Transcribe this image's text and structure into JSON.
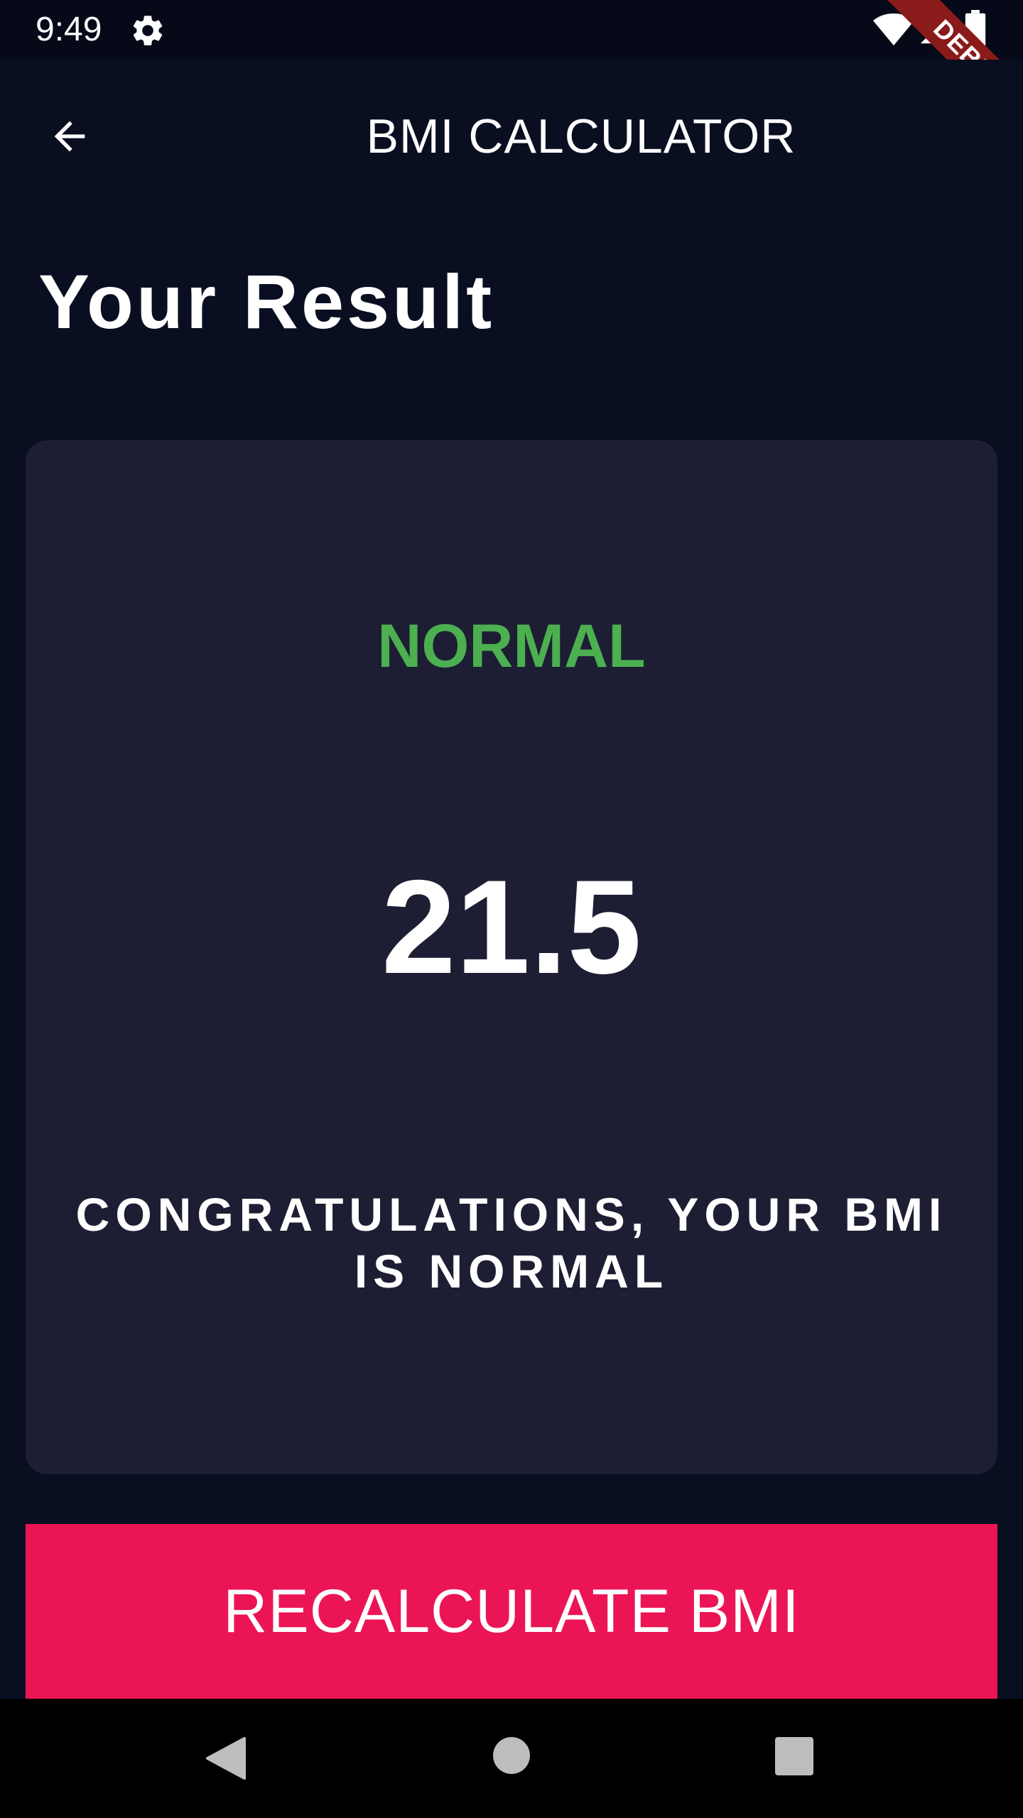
{
  "status_bar": {
    "time": "9:49",
    "icons": [
      "gear-icon",
      "wifi-icon",
      "signal-icon",
      "battery-icon"
    ]
  },
  "debug_banner": {
    "label": "DEBUG"
  },
  "app_bar": {
    "title": "BMI CALCULATOR",
    "back_icon": "arrow-back-icon"
  },
  "page": {
    "heading": "Your Result"
  },
  "result": {
    "category": "NORMAL",
    "bmi_value": "21.5",
    "message": "CONGRATULATIONS, YOUR BMI IS NORMAL"
  },
  "actions": {
    "recalculate_label": "RECALCULATE BMI"
  },
  "nav_bar": {
    "icons": [
      "nav-back-icon",
      "nav-home-icon",
      "nav-recents-icon"
    ]
  },
  "colors": {
    "background": "#0a0e21",
    "card": "#1d1e33",
    "category_normal": "#4caf50",
    "accent_button": "#eb1555",
    "debug_banner": "#8b1a1a"
  }
}
